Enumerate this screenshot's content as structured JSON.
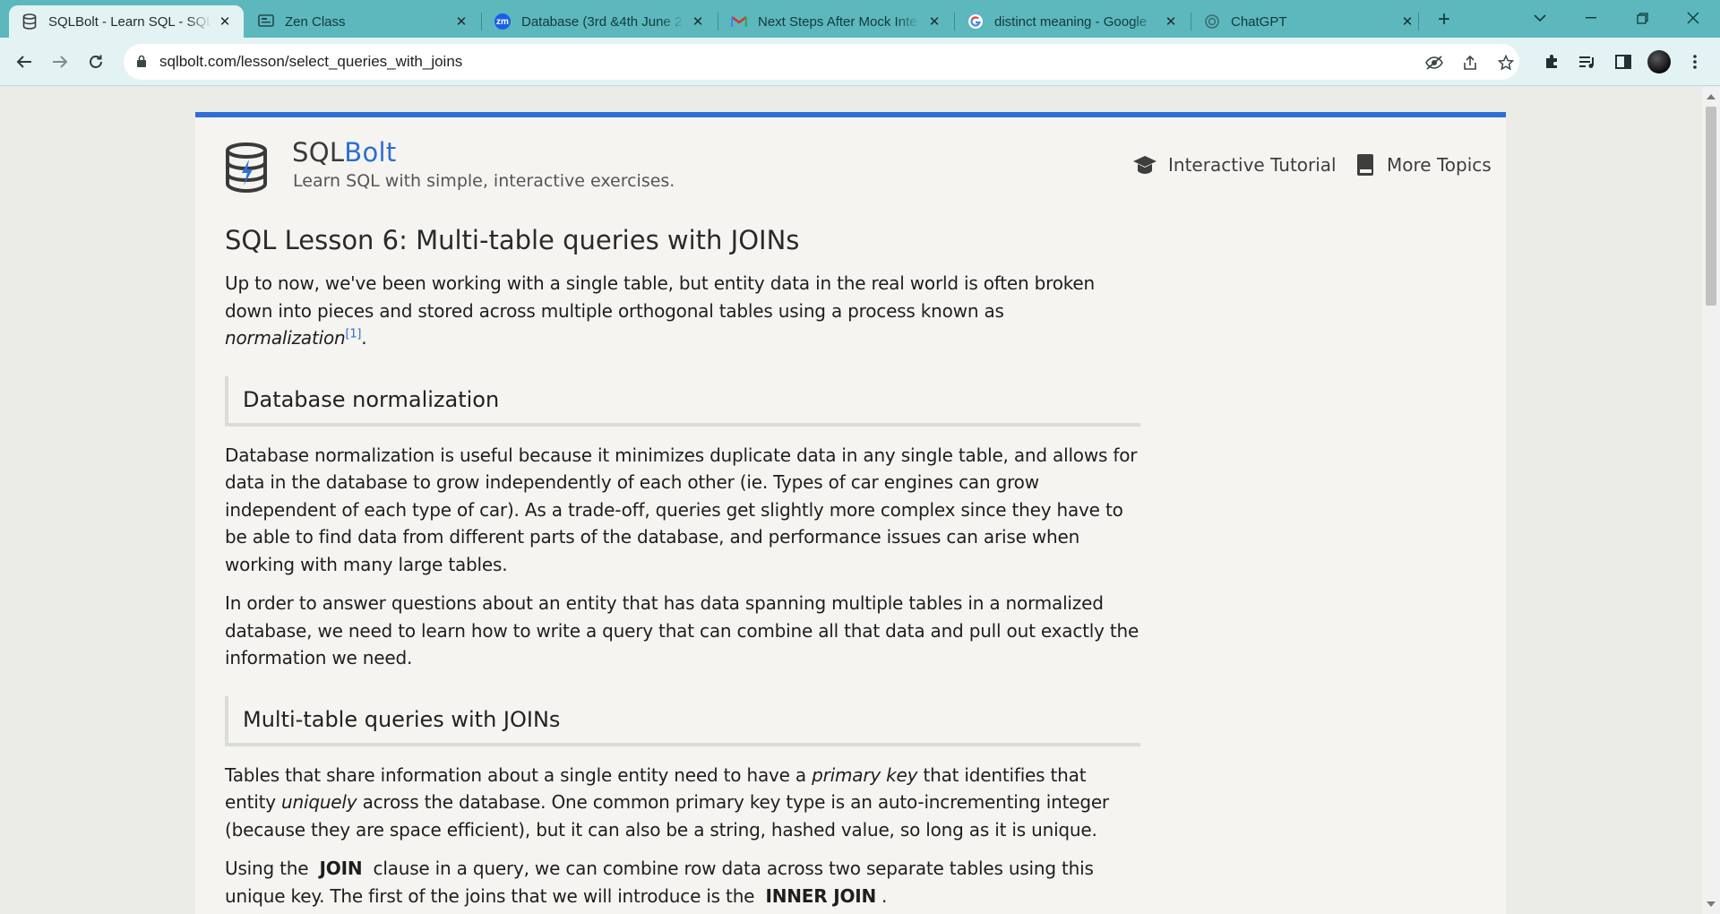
{
  "browser": {
    "tabs": [
      {
        "title": "SQLBolt - Learn SQL - SQL",
        "icon": "database-icon",
        "active": true
      },
      {
        "title": "Zen Class",
        "icon": "zen-class-icon",
        "active": false
      },
      {
        "title": "Database (3rd &4th June 2",
        "icon": "zoom-icon",
        "favicon_text": "zm",
        "active": false
      },
      {
        "title": "Next Steps After Mock Inte",
        "icon": "gmail-icon",
        "active": false
      },
      {
        "title": "distinct meaning - Google",
        "icon": "google-icon",
        "active": false
      },
      {
        "title": "ChatGPT",
        "icon": "chatgpt-icon",
        "active": false
      }
    ],
    "url": "sqlbolt.com/lesson/select_queries_with_joins",
    "colors": {
      "tabstrip": "#5cb8bd",
      "toolbar": "#e3f3f3",
      "accent": "#2f6fd6"
    }
  },
  "site": {
    "brand_part1": "SQL",
    "brand_part2": "Bolt",
    "tagline": "Learn SQL with simple, interactive exercises.",
    "nav": {
      "tutorial": "Interactive Tutorial",
      "topics": "More Topics"
    }
  },
  "lesson": {
    "title": "SQL Lesson 6: Multi-table queries with JOINs",
    "intro_text": "Up to now, we've been working with a single table, but entity data in the real world is often broken down into pieces and stored across multiple orthogonal tables using a process known as ",
    "intro_em": "normalization",
    "intro_ref": "[1]",
    "intro_end": ".",
    "section1_title": "Database normalization",
    "section1_p1": "Database normalization is useful because it minimizes duplicate data in any single table, and allows for data in the database to grow independently of each other (ie. Types of car engines can grow independent of each type of car). As a trade-off, queries get slightly more complex since they have to be able to find data from different parts of the database, and performance issues can arise when working with many large tables.",
    "section1_p2": "In order to answer questions about an entity that has data spanning multiple tables in a normalized database, we need to learn how to write a query that can combine all that data and pull out exactly the information we need.",
    "section2_title": "Multi-table queries with JOINs",
    "s2p1_a": "Tables that share information about a single entity need to have a ",
    "s2p1_em1": "primary key",
    "s2p1_b": " that identifies that entity ",
    "s2p1_em2": "uniquely",
    "s2p1_c": " across the database. One common primary key type is an auto-incrementing integer (because they are space efficient), but it can also be a string, hashed value, so long as it is unique.",
    "s2p2_a": "Using the ",
    "s2p2_kw1": "JOIN",
    "s2p2_b": " clause in a query, we can combine row data across two separate tables using this unique key. The first of the joins that we will introduce is the ",
    "s2p2_kw2": "INNER JOIN",
    "s2p2_c": "."
  }
}
